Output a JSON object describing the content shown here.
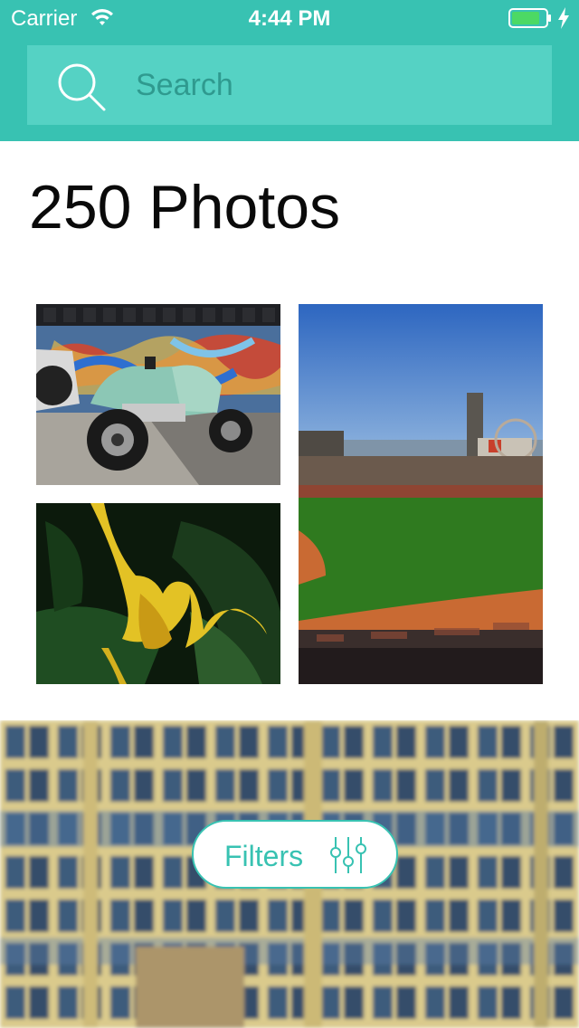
{
  "status_bar": {
    "carrier": "Carrier",
    "time": "4:44 PM",
    "icons": [
      "wifi-icon",
      "battery-icon",
      "charging-icon"
    ],
    "battery_color": "#4cd964"
  },
  "search": {
    "placeholder": "Search",
    "value": "",
    "icon": "search-icon"
  },
  "header": {
    "background_color": "#38c2b2",
    "search_background_color": "#55d2c4"
  },
  "gallery": {
    "title": "250 Photos",
    "photos": [
      {
        "name": "scooter-graffiti"
      },
      {
        "name": "ballpark-stadium"
      },
      {
        "name": "yellow-flower"
      },
      {
        "name": "industrial-windows"
      }
    ]
  },
  "filters": {
    "label": "Filters",
    "icon": "sliders-icon",
    "accent_color": "#38c2b2"
  }
}
